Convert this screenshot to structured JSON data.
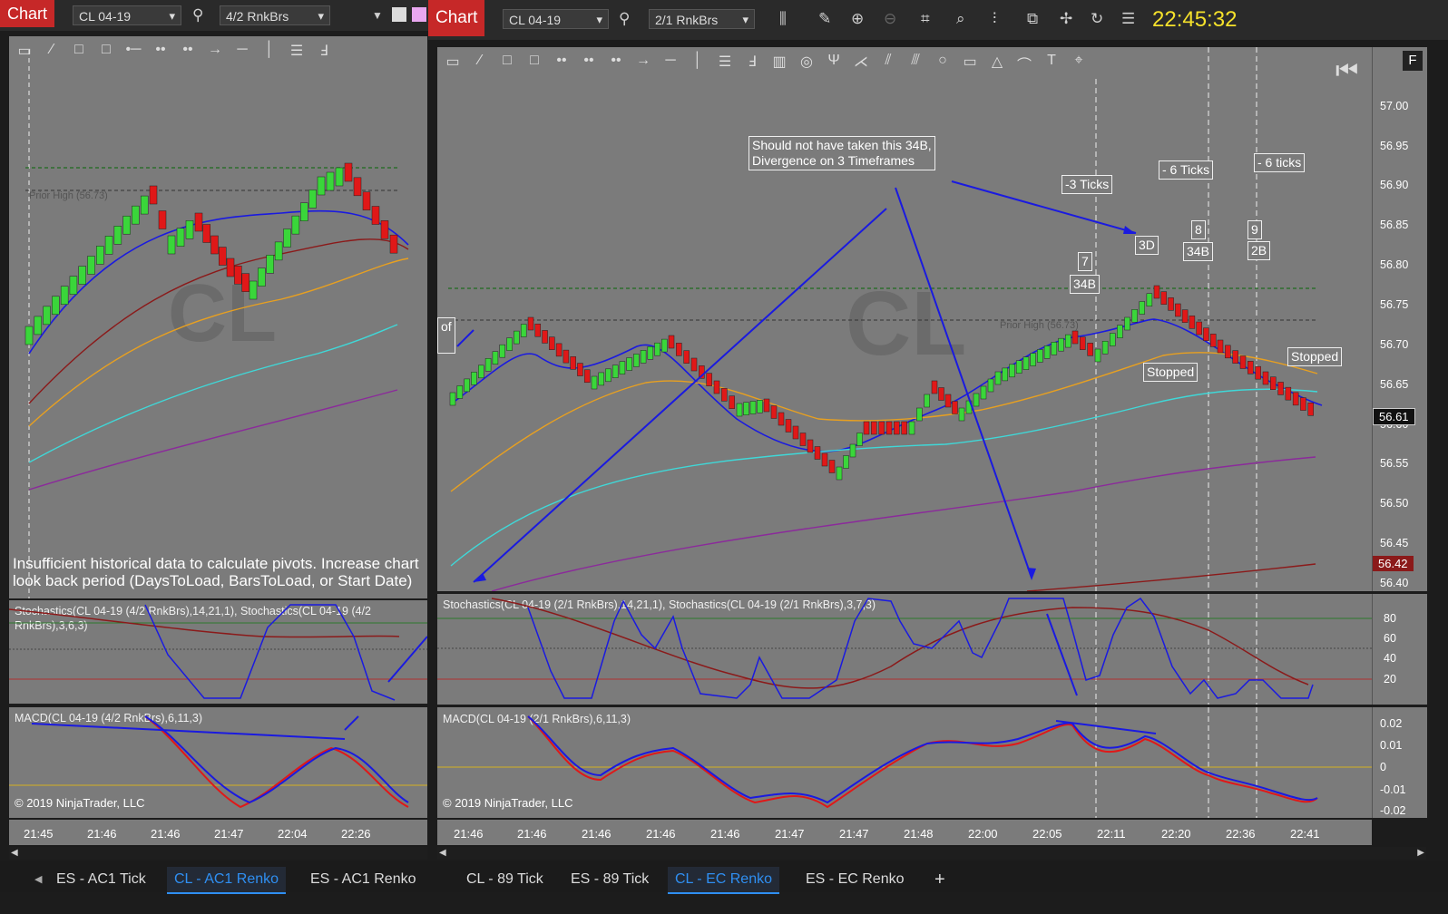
{
  "left": {
    "chart_label": "Chart",
    "instrument": "CL 04-19",
    "bar_type": "4/2 RnkBrs",
    "prior_high": "Prior High (56.73)",
    "watermark": "CL",
    "pivot_message_1": "Insufficient historical data to calculate pivots. Increase chart",
    "pivot_message_2": "look back period (DaysToLoad, BarsToLoad, or Start Date)",
    "stoch_title_1": "Stochastics(CL 04-19 (4/2 RnkBrs),14,21,1), Stochastics(CL 04-19 (4/2",
    "stoch_title_2": "RnkBrs),3,6,3)",
    "macd_title": "MACD(CL 04-19 (4/2 RnkBrs),6,11,3)",
    "copyright": "© 2019 NinjaTrader, LLC",
    "x_labels": [
      "21:45",
      "21:46",
      "21:46",
      "21:47",
      "22:04",
      "22:26"
    ],
    "tabs": [
      "ES - AC1 Tick",
      "CL - AC1 Renko",
      "ES - AC1 Renko"
    ],
    "active_tab": 1
  },
  "right": {
    "chart_label": "Chart",
    "instrument": "CL 04-19",
    "bar_type": "2/1 RnkBrs",
    "clock": "22:45:32",
    "watermark": "CL",
    "prior_high": "Prior High (56.73)",
    "stoch_title": "Stochastics(CL 04-19 (2/1 RnkBrs),14,21,1), Stochastics(CL 04-19 (2/1 RnkBrs),3,7,3)",
    "macd_title": "MACD(CL 04-19 (2/1 RnkBrs),6,11,3)",
    "copyright": "© 2019 NinjaTrader, LLC",
    "price_ticks": [
      "57.00",
      "56.95",
      "56.90",
      "56.85",
      "56.80",
      "56.75",
      "56.70",
      "56.65",
      "56.60",
      "56.55",
      "56.50",
      "56.45",
      "56.40"
    ],
    "last_price": "56.61",
    "low_price": "56.42",
    "stoch_ticks": [
      "80",
      "60",
      "40",
      "20"
    ],
    "macd_ticks": [
      "0.02",
      "0.01",
      "0",
      "-0.01",
      "-0.02"
    ],
    "x_labels": [
      "21:46",
      "21:46",
      "21:46",
      "21:46",
      "21:46",
      "21:47",
      "21:47",
      "21:48",
      "22:00",
      "22:05",
      "22:11",
      "22:20",
      "22:36",
      "22:41"
    ],
    "annotations": {
      "note": "Should not have taken this 34B,\nDivergence on 3 Timeframes",
      "ticks_a": "-3  Ticks",
      "ticks_b": "- 6 Ticks",
      "ticks_c": "- 6 ticks",
      "label_3d": "3D",
      "num_7": "7",
      "label_34b_1": "34B",
      "num_8": "8",
      "label_34b_2": "34B",
      "num_9": "9",
      "label_2b": "2B",
      "stopped_1": "Stopped",
      "stopped_2": "Stopped",
      "of": "of",
      "f_badge": "F"
    },
    "tabs": [
      "CL - 89 Tick",
      "ES - 89 Tick",
      "CL - EC Renko",
      "ES - EC Renko"
    ],
    "active_tab": 2,
    "add_tab": "+"
  },
  "colors": {
    "bull": "#3ad63a",
    "bear": "#e01818",
    "ema_fast": "#1a1ae0",
    "ema_orange": "#e8a020",
    "ema_dark": "#8b1a1a",
    "ema_cyan": "#3fd8d8",
    "ema_purple": "#8b2a9b",
    "chart_bg": "#7b7b7b"
  }
}
